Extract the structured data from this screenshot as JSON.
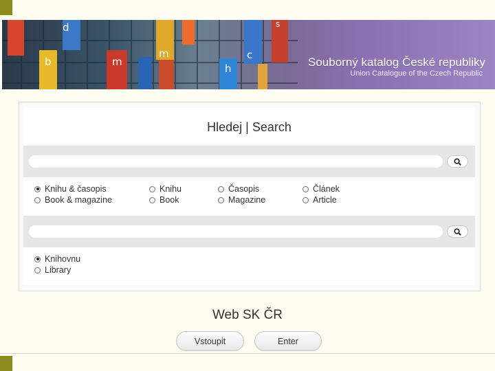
{
  "banner": {
    "title": "Souborný katalog České republiky",
    "subtitle": "Union Catalogue of the Czech Republic",
    "letters": [
      "d",
      "b",
      "m",
      "m",
      "h",
      "c",
      "s"
    ]
  },
  "search": {
    "title": "Hledej | Search",
    "query1_value": "",
    "query2_value": "",
    "doc_types": [
      {
        "cz": "Knihu & časopis",
        "en": "Book & magazine",
        "selected": true
      },
      {
        "cz": "Knihu",
        "en": "Book",
        "selected": false
      },
      {
        "cz": "Časopis",
        "en": "Magazine",
        "selected": false
      },
      {
        "cz": "Článek",
        "en": "Article",
        "selected": false
      }
    ],
    "library_options": [
      {
        "label": "Knihovnu",
        "selected": true
      },
      {
        "label": "Library",
        "selected": false
      }
    ]
  },
  "web": {
    "title": "Web SK ČR",
    "enter_cz": "Vstoupit",
    "enter_en": "Enter"
  },
  "colors": {
    "accent_square": "#8c8c1e",
    "page_background": "#fdfdf2",
    "bar_gray": "#e6e6e6"
  },
  "icons": {
    "search_button": "search-icon"
  }
}
